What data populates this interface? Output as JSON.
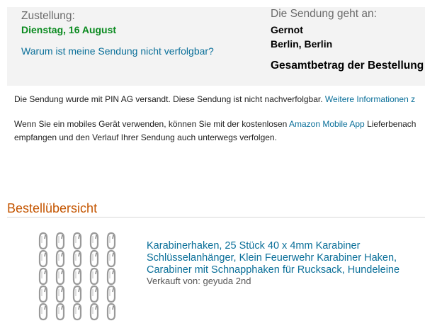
{
  "delivery": {
    "label": "Zustellung:",
    "date": "Dienstag, 16 August",
    "tracking_link": "Warum ist meine Sendung nicht verfolgbar?"
  },
  "recipient": {
    "label": "Die Sendung geht an:",
    "name": "Gernot",
    "city": "Berlin, Berlin"
  },
  "order_total_label": "Gesamtbetrag der Bestellung",
  "shipping_notice": {
    "text": "Die Sendung wurde mit PIN AG versandt. Diese Sendung ist nicht nachverfolgbar.",
    "link": "Weitere Informationen z"
  },
  "app_notice": {
    "text_before": "Wenn Sie ein mobiles Gerät verwenden, können Sie mit der kostenlosen",
    "link": "Amazon Mobile App",
    "text_after": "Lieferbenach",
    "line2": "empfangen und den Verlauf Ihrer Sendung auch unterwegs verfolgen."
  },
  "order_overview": {
    "heading": "Bestellübersicht",
    "item": {
      "title_lines": [
        "Karabinerhaken, 25 Stück 40 x 4mm Karabiner",
        "Schlüsselanhänger, Klein Feuerwehr Karabiner Haken,",
        "Carabiner mit Schnapphaken für Rucksack, Hundeleine"
      ],
      "seller": "Verkauft von: geyuda 2nd",
      "image_icon": "carabiner-hooks-image"
    }
  },
  "colors": {
    "link": "#0a6f99",
    "delivery_date": "#0a8a1f",
    "heading": "#c45500",
    "panel_bg": "#f3f3f3"
  }
}
